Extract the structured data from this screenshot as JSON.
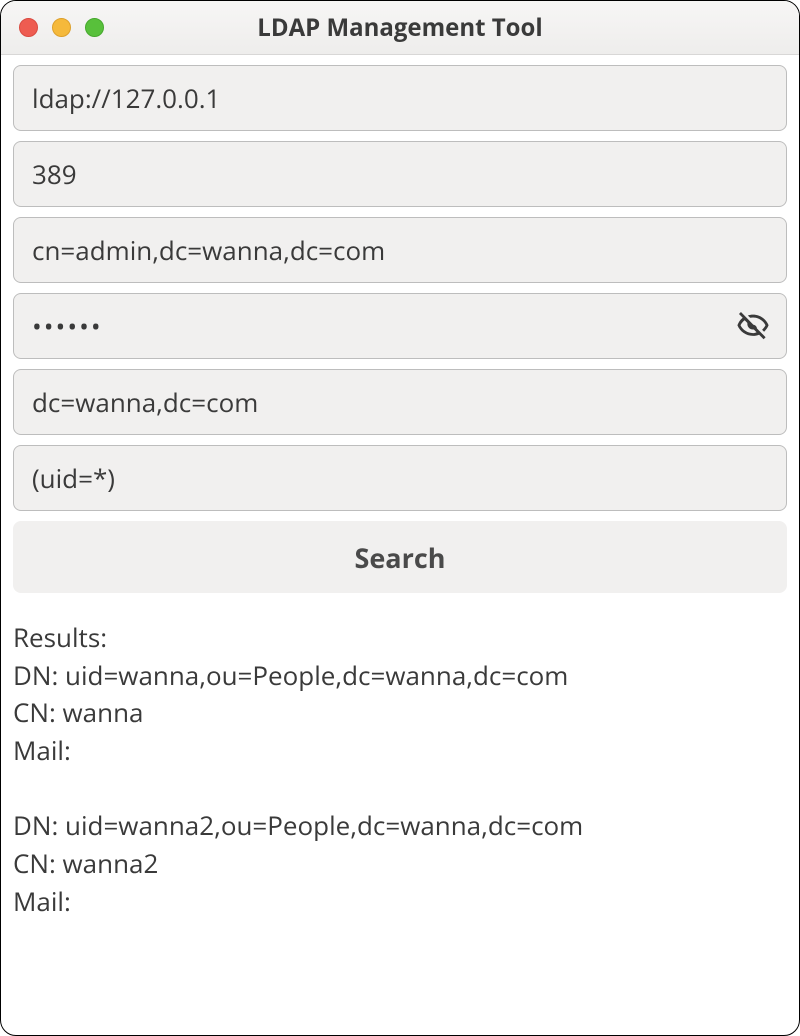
{
  "window": {
    "title": "LDAP Management Tool"
  },
  "form": {
    "server": "ldap://127.0.0.1",
    "port": "389",
    "bind_dn": "cn=admin,dc=wanna,dc=com",
    "password": "••••••",
    "base_dn": "dc=wanna,dc=com",
    "filter": "(uid=*)",
    "search_label": "Search"
  },
  "results": {
    "header": "Results:",
    "entries": [
      {
        "dn": "uid=wanna,ou=People,dc=wanna,dc=com",
        "cn": "wanna",
        "mail": ""
      },
      {
        "dn": "uid=wanna2,ou=People,dc=wanna,dc=com",
        "cn": "wanna2",
        "mail": ""
      }
    ]
  }
}
